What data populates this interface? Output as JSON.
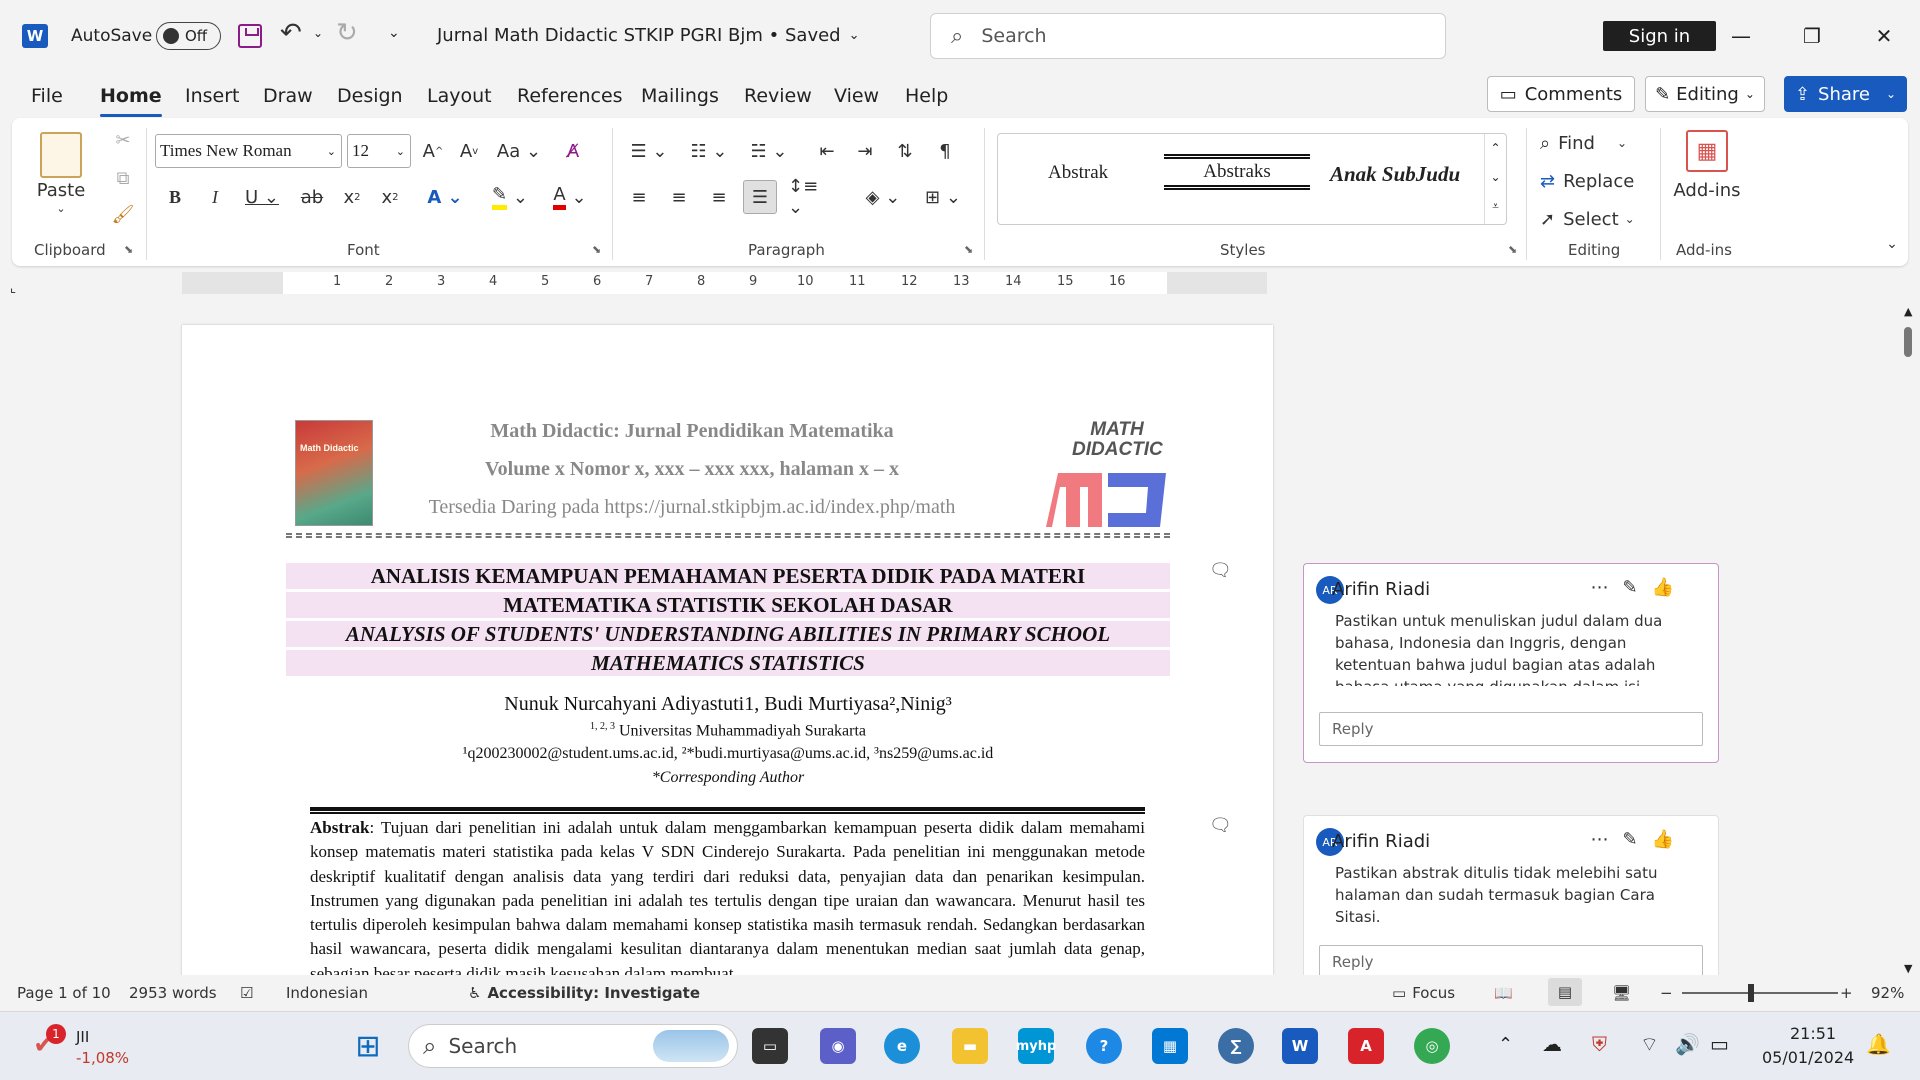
{
  "titlebar": {
    "autosave_label": "AutoSave",
    "autosave_state": "Off",
    "doc_title": "Jurnal Math Didactic STKIP PGRI Bjm • Saved",
    "search_placeholder": "Search",
    "signin_label": "Sign in"
  },
  "tabs": [
    "File",
    "Home",
    "Insert",
    "Draw",
    "Design",
    "Layout",
    "References",
    "Mailings",
    "Review",
    "View",
    "Help"
  ],
  "tab_actions": {
    "comments": "Comments",
    "editing": "Editing",
    "share": "Share"
  },
  "ribbon": {
    "paste_label": "Paste",
    "clipboard_label": "Clipboard",
    "font_name": "Times New Roman",
    "font_size": "12",
    "font_label": "Font",
    "paragraph_label": "Paragraph",
    "styles": [
      "Abstrak",
      "Abstraks",
      "Anak SubJudu"
    ],
    "styles_label": "Styles",
    "find_label": "Find",
    "replace_label": "Replace",
    "select_label": "Select",
    "editing_label": "Editing",
    "addins_label": "Add-ins",
    "addins_group_label": "Add-ins"
  },
  "ruler": {
    "numbers": [
      "1",
      "2",
      "3",
      "4",
      "5",
      "6",
      "7",
      "8",
      "9",
      "10",
      "11",
      "12",
      "13",
      "14",
      "15",
      "16"
    ]
  },
  "document": {
    "journal_cover_text": "Math Didactic",
    "header_line1": "Math Didactic: Jurnal Pendidikan Matematika",
    "header_line2": "Volume x Nomor x, xxx – xxx xxx, halaman x – x",
    "header_line3": "Tersedia Daring pada https://jurnal.stkipbjm.ac.id/index.php/math",
    "logo_text": "MATH DIDACTIC",
    "title_id_1": "ANALISIS KEMAMPUAN PEMAHAMAN PESERTA DIDIK PADA MATERI",
    "title_id_2": "MATEMATIKA STATISTIK SEKOLAH DASAR",
    "title_en_1": "ANALYSIS OF STUDENTS' UNDERSTANDING ABILITIES IN PRIMARY SCHOOL",
    "title_en_2": "MATHEMATICS STATISTICS",
    "authors": "Nunuk Nurcahyani Adiyastuti1, Budi Murtiyasa²,Ninig³",
    "affiliation_sup": "1, 2, 3",
    "affiliation": "Universitas Muhammadiyah Surakarta",
    "emails": "¹q200230002@student.ums.ac.id, ²*budi.murtiyasa@ums.ac.id, ³ns259@ums.ac.id",
    "corresponding": "*Corresponding Author",
    "abstract_label": "Abstrak",
    "abstract_text": ": Tujuan dari penelitian ini adalah untuk dalam menggambarkan kemampuan peserta didik dalam memahami konsep matematis materi statistika pada kelas V SDN Cinderejo Surakarta. Pada penelitian ini menggunakan metode deskriptif kualitatif dengan analisis data yang terdiri dari reduksi data, penyajian data dan penarikan kesimpulan. Instrumen yang digunakan pada penelitian ini adalah tes tertulis dengan tipe uraian dan wawancara. Menurut hasil tes tertulis diperoleh kesimpulan bahwa dalam memahami konsep statistika masih termasuk rendah. Sedangkan berdasarkan hasil wawancara, peserta didik mengalami kesulitan diantaranya dalam menentukan median saat jumlah data genap, sebagian besar peserta didik masih kesusahan dalam membuat"
  },
  "comments": [
    {
      "initials": "AR",
      "author": "Arifin Riadi",
      "text": "Pastikan untuk menuliskan judul dalam dua bahasa, Indonesia dan Inggris, dengan ketentuan bahwa judul bagian atas adalah bahasa utama yang digunakan dalam isi",
      "reply_placeholder": "Reply"
    },
    {
      "initials": "AR",
      "author": "Arifin Riadi",
      "text": "Pastikan abstrak ditulis tidak melebihi satu halaman dan sudah termasuk bagian Cara Sitasi.",
      "reply_placeholder": "Reply"
    }
  ],
  "statusbar": {
    "page": "Page 1 of 10",
    "words": "2953 words",
    "language": "Indonesian",
    "accessibility": "Accessibility: Investigate",
    "focus": "Focus",
    "zoom": "92%"
  },
  "taskbar": {
    "stock_name": "JII",
    "stock_change": "-1,08%",
    "stock_badge": "1",
    "search_placeholder": "Search",
    "time": "21:51",
    "date": "05/01/2024"
  },
  "colors": {
    "accent": "#185abd",
    "title_highlight": "#f4e1f1",
    "comment_border": "#c893c8"
  }
}
